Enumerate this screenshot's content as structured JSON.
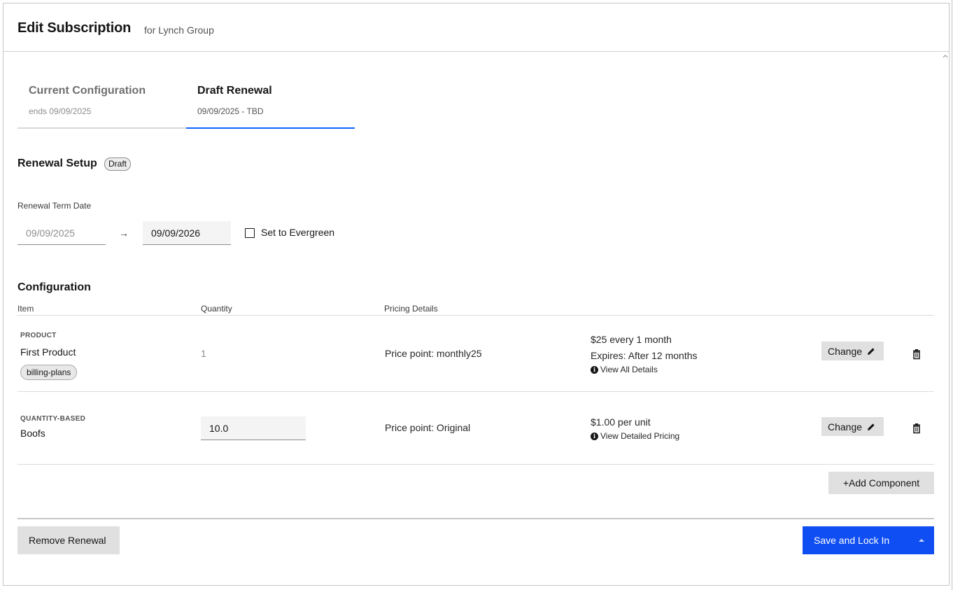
{
  "header": {
    "title": "Edit Subscription",
    "subtitle": "for Lynch Group"
  },
  "tabs": [
    {
      "label": "Current Configuration",
      "sub": "ends 09/09/2025",
      "active": false
    },
    {
      "label": "Draft Renewal",
      "sub": "09/09/2025 - TBD",
      "active": true
    }
  ],
  "renewal": {
    "title": "Renewal Setup",
    "badge": "Draft",
    "term_label": "Renewal Term Date",
    "start_date": "09/09/2025",
    "end_date": "09/09/2026",
    "evergreen_label": "Set to Evergreen",
    "evergreen_checked": false
  },
  "configuration": {
    "title": "Configuration",
    "columns": {
      "item": "Item",
      "quantity": "Quantity",
      "pricing": "Pricing Details"
    },
    "rows": [
      {
        "kind": "PRODUCT",
        "name": "First Product",
        "tag": "billing-plans",
        "quantity": "1",
        "price_point": "Price point: monthly25",
        "detail_1": "$25 every 1 month",
        "detail_2": "Expires: After 12 months",
        "link": "View All Details",
        "change_label": "Change"
      },
      {
        "kind": "QUANTITY-BASED",
        "name": "Boofs",
        "quantity": "10.0",
        "price_point": "Price point: Original",
        "detail_1": "$1.00 per unit",
        "link": "View Detailed Pricing",
        "change_label": "Change"
      }
    ],
    "add_label": "+Add Component"
  },
  "footer": {
    "remove_label": "Remove Renewal",
    "save_label": "Save and Lock In"
  },
  "colors": {
    "primary": "#0f4ef2",
    "tab_active": "#0f62fe",
    "button_gray": "#e0e0e0"
  }
}
